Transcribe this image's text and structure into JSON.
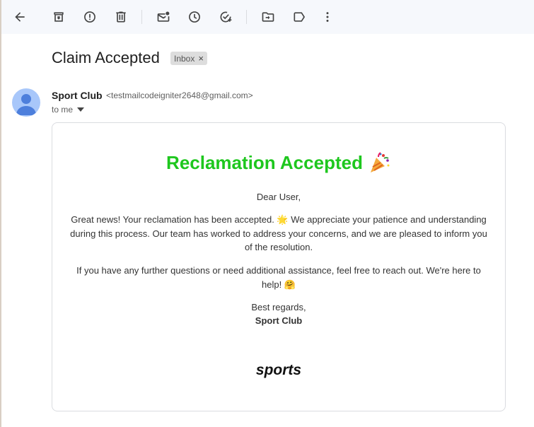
{
  "toolbar": {
    "icons": [
      "back-arrow-icon",
      "archive-icon",
      "report-spam-icon",
      "delete-icon",
      "mark-unread-icon",
      "snooze-icon",
      "add-task-icon",
      "move-to-icon",
      "label-icon",
      "more-vert-icon"
    ]
  },
  "email": {
    "subject": "Claim Accepted",
    "label_chip": "Inbox",
    "label_chip_close": "×",
    "sender_name": "Sport Club",
    "sender_email": "<testmailcodeigniter2648@gmail.com>",
    "recipient": "to me"
  },
  "body": {
    "heading": "Reclamation Accepted",
    "heading_emoji": "party-popper-icon",
    "greeting": "Dear User,",
    "para1": "Great news! Your reclamation has been accepted. 🌟 We appreciate your patience and understanding during this process. Our team has worked to address your concerns, and we are pleased to inform you of the resolution.",
    "para2": "If you have any further questions or need additional assistance, feel free to reach out. We're here to help! 🤗",
    "closing": "Best regards,",
    "signature": "Sport Club",
    "logo_text": "sports"
  },
  "colors": {
    "heading_green": "#1ec71e",
    "toolbar_bg": "#f6f8fc",
    "avatar_bg": "#a8c7fa",
    "avatar_fg": "#4d7fdc"
  }
}
